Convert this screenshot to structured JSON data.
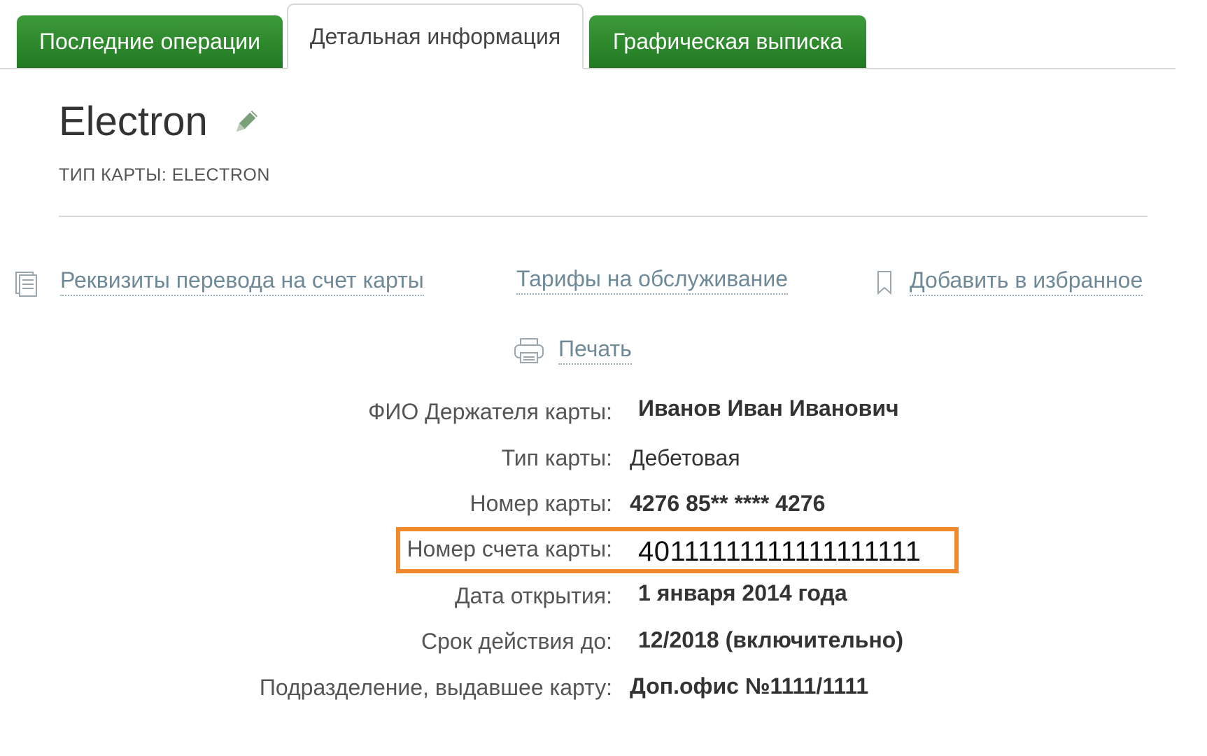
{
  "tabs": [
    {
      "label": "Последние операции"
    },
    {
      "label": "Детальная информация"
    },
    {
      "label": "Графическая выписка"
    }
  ],
  "card": {
    "title": "Electron",
    "type_line": "ТИП КАРТЫ: ELECTRON"
  },
  "actions": {
    "requisites": "Реквизиты перевода на счет карты",
    "tariffs": "Тарифы на обслуживание",
    "favorite": "Добавить в избранное",
    "print": "Печать"
  },
  "details": [
    {
      "label": "ФИО Держателя карты:",
      "value": "Иванов Иван Иванович"
    },
    {
      "label": "Тип карты:",
      "value": "Дебетовая"
    },
    {
      "label": "Номер карты:",
      "value": "4276 85** **** 4276"
    },
    {
      "label": "Номер счета карты:",
      "value": "40111111111111111111"
    },
    {
      "label": "Дата открытия:",
      "value": "1 января 2014 года"
    },
    {
      "label": "Срок действия до:",
      "value": "12/2018 (включительно)"
    },
    {
      "label": "Подразделение, выдавшее карту:",
      "value": "Доп.офис №1111/1111"
    }
  ],
  "colors": {
    "tab_green": "#2e8b2e",
    "link": "#6e8a98",
    "highlight": "#f08a2c"
  },
  "icons": [
    "pencil-icon",
    "document-icon",
    "bookmark-icon",
    "printer-icon"
  ]
}
